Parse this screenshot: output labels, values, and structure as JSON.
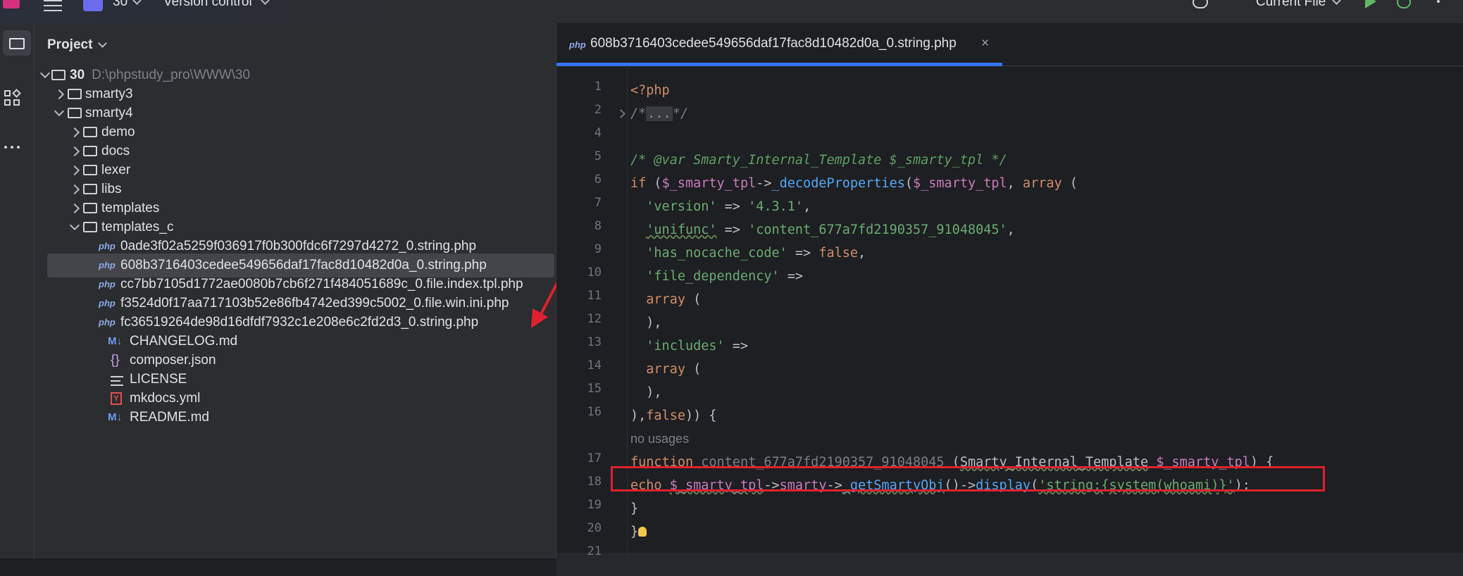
{
  "topbar": {
    "project_name": "30",
    "vcs_label": "Version control",
    "run_config": "Current File"
  },
  "project_panel": {
    "title": "Project",
    "root": {
      "name": "30",
      "path": "D:\\phpstudy_pro\\WWW\\30"
    },
    "items": [
      {
        "label": "smarty3",
        "type": "folder",
        "expanded": false
      },
      {
        "label": "smarty4",
        "type": "folder",
        "expanded": true
      },
      {
        "label": "demo",
        "type": "folder",
        "expanded": false
      },
      {
        "label": "docs",
        "type": "folder",
        "expanded": false
      },
      {
        "label": "lexer",
        "type": "folder",
        "expanded": false
      },
      {
        "label": "libs",
        "type": "folder",
        "expanded": false
      },
      {
        "label": "templates",
        "type": "folder",
        "expanded": false
      },
      {
        "label": "templates_c",
        "type": "folder",
        "expanded": true
      },
      {
        "label": "0ade3f02a5259f036917f0b300fdc6f7297d4272_0.string.php",
        "type": "php"
      },
      {
        "label": "608b3716403cedee549656daf17fac8d10482d0a_0.string.php",
        "type": "php",
        "selected": true
      },
      {
        "label": "cc7bb7105d1772ae0080b7cb6f271f484051689c_0.file.index.tpl.php",
        "type": "php"
      },
      {
        "label": "f3524d0f17aa717103b52e86fb4742ed399c5002_0.file.win.ini.php",
        "type": "php"
      },
      {
        "label": "fc36519264de98d16dfdf7932c1e208e6c2fd2d3_0.string.php",
        "type": "php"
      },
      {
        "label": "CHANGELOG.md",
        "type": "md"
      },
      {
        "label": "composer.json",
        "type": "json"
      },
      {
        "label": "LICENSE",
        "type": "text"
      },
      {
        "label": "mkdocs.yml",
        "type": "yml"
      },
      {
        "label": "README.md",
        "type": "md"
      }
    ],
    "file_type_badges": {
      "php": "php",
      "md": "M↓",
      "json": "{}",
      "yml": "Y"
    }
  },
  "editor": {
    "tab": {
      "badge": "php",
      "label": "608b3716403cedee549656daf17fac8d10482d0a_0.string.php",
      "close": "×"
    },
    "line_numbers": [
      "1",
      "2",
      "4",
      "5",
      "6",
      "7",
      "8",
      "9",
      "10",
      "11",
      "12",
      "13",
      "14",
      "15",
      "16",
      "17",
      "18",
      "19",
      "20",
      "21"
    ],
    "code": {
      "l1": "<?php",
      "l2_open": "/*",
      "l2_fold": "...",
      "l2_close": "*/",
      "l5": "/* @var Smarty_Internal_Template $_smarty_tpl */",
      "l6_if": "if",
      "l6_var": "$_smarty_tpl",
      "l6_arrow": "->",
      "l6_fn": "_decodeProperties",
      "l6_var2": "$_smarty_tpl",
      "l6_array": "array",
      "l7_key": "'version'",
      "l7_val": "'4.3.1'",
      "l8_key": "'unifunc'",
      "l8_val": "'content_677a7fd2190357_91048045'",
      "l9_key": "'has_nocache_code'",
      "l9_val": "false",
      "l10_key": "'file_dependency'",
      "l11": "array",
      "l12": "),",
      "l13_key": "'includes'",
      "l14": "array",
      "l15": "),",
      "l16_false": "false",
      "usage_hint": "no usages",
      "l17_function": "function",
      "l17_name": "content_677a7fd2190357_91048045",
      "l17_type": "Smarty_Internal_Template",
      "l17_var": "$_smarty_tpl",
      "l18_echo": "echo",
      "l18_var": "$_smarty_tpl",
      "l18_prop": "smarty",
      "l18_fn": "_getSmartyObj",
      "l18_fn2": "display",
      "l18_str": "'string:{system(whoami)}'",
      "l19": "}",
      "l20": "}"
    }
  }
}
